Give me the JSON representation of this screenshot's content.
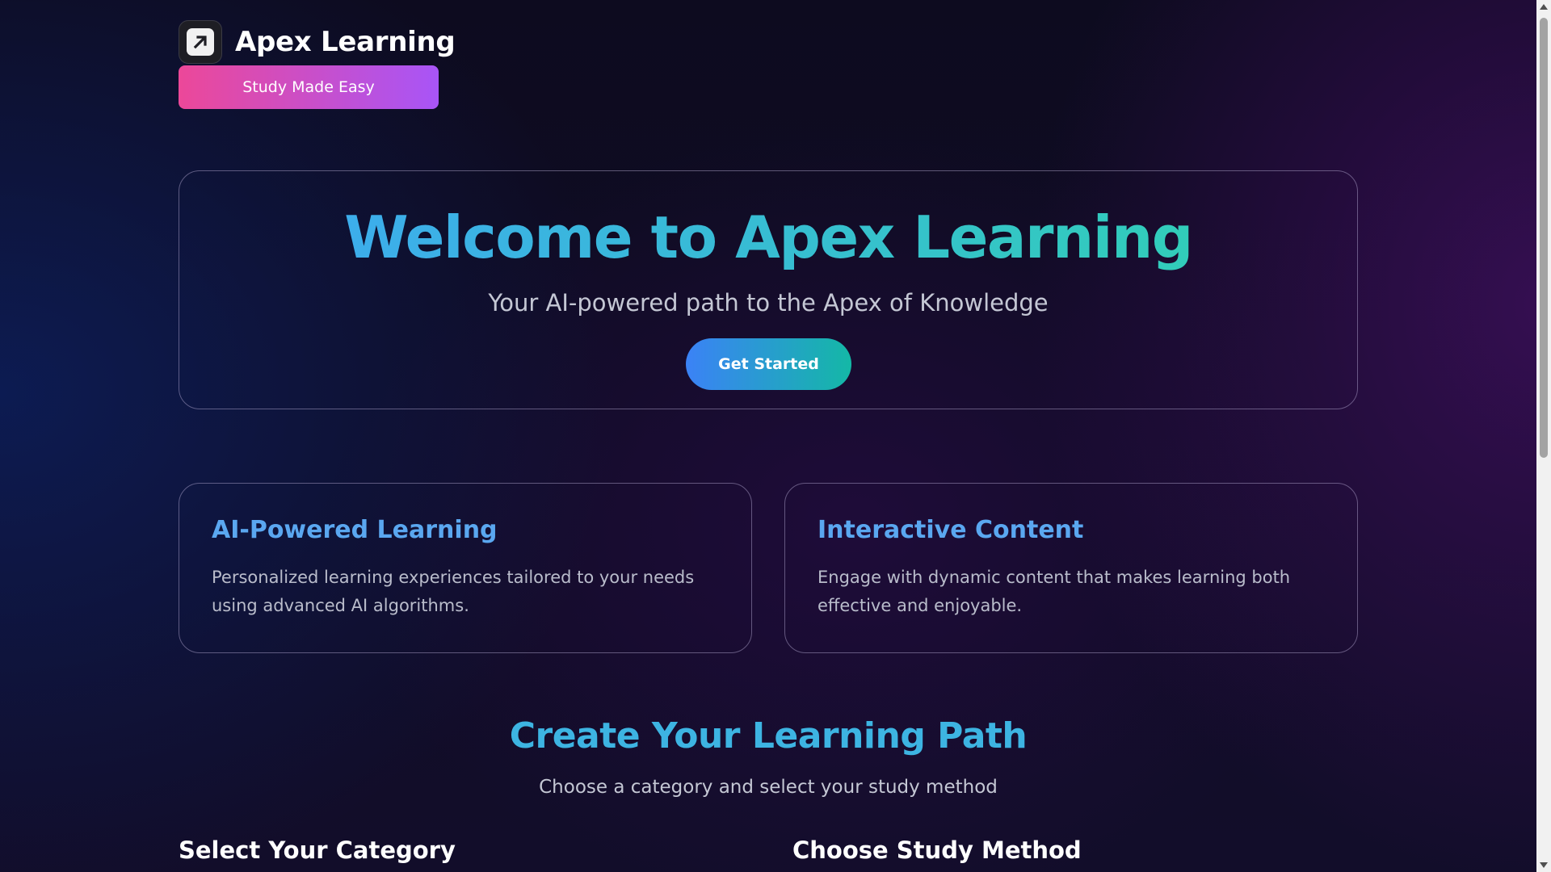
{
  "header": {
    "brand_name": "Apex Learning",
    "tagline": "Study Made Easy",
    "logo_icon": "arrow-up-right-icon"
  },
  "hero": {
    "title": "Welcome to Apex Learning",
    "subtitle": "Your AI-powered path to the Apex of Knowledge",
    "cta_label": "Get Started"
  },
  "features": [
    {
      "title": "AI-Powered Learning",
      "text": "Personalized learning experiences tailored to your needs using advanced AI algorithms."
    },
    {
      "title": "Interactive Content",
      "text": "Engage with dynamic content that makes learning both effective and enjoyable."
    }
  ],
  "path_section": {
    "title": "Create Your Learning Path",
    "subtitle": "Choose a category and select your study method",
    "category_heading": "Select Your Category",
    "method_heading": "Choose Study Method"
  },
  "colors": {
    "tagline_gradient": [
      "#ec4899",
      "#a855f7"
    ],
    "hero_title_gradient": [
      "#3fa7f5",
      "#2fd3b0"
    ],
    "cta_gradient": [
      "#3b82f6",
      "#14b8a6"
    ],
    "feature_title": "#5aa7f0",
    "section_title": "#3db4e2"
  }
}
